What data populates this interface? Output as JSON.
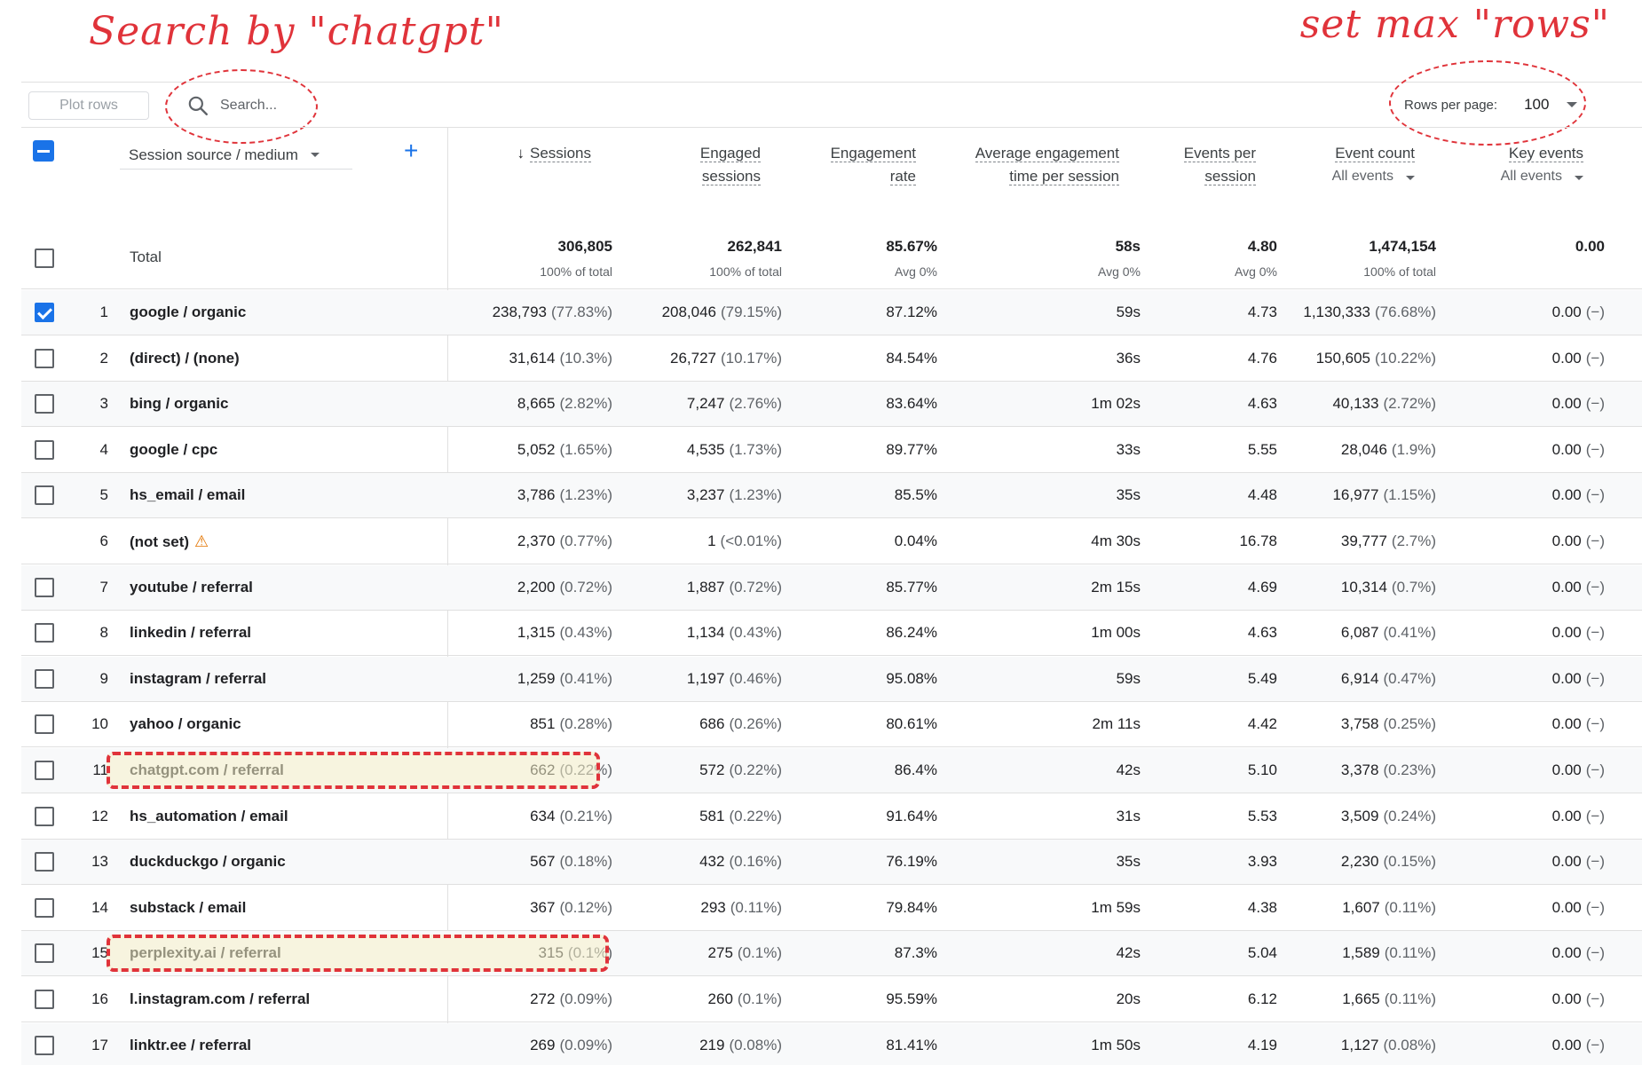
{
  "annotations": {
    "left": "Search by \"chatgpt\"",
    "right": "set max \"rows\""
  },
  "toolbar": {
    "plot_rows": "Plot rows",
    "search_placeholder": "Search...",
    "rows_per_page_label": "Rows per page:",
    "rows_per_page_value": "100"
  },
  "dimension": {
    "label": "Session source / medium"
  },
  "columns": [
    {
      "line1": "Sessions",
      "line2": "",
      "sort": true
    },
    {
      "line1": "Engaged",
      "line2": "sessions"
    },
    {
      "line1": "Engagement",
      "line2": "rate"
    },
    {
      "line1": "Average engagement",
      "line2": "time per session"
    },
    {
      "line1": "Events per",
      "line2": "session"
    },
    {
      "line1": "Event count",
      "line2": "All events"
    },
    {
      "line1": "Key events",
      "line2": "All events"
    }
  ],
  "total": {
    "label": "Total",
    "sessions": "306,805",
    "sessions_sub": "100% of total",
    "engaged": "262,841",
    "engaged_sub": "100% of total",
    "rate": "85.67%",
    "rate_sub": "Avg 0%",
    "avg_time": "58s",
    "avg_time_sub": "Avg 0%",
    "eps": "4.80",
    "eps_sub": "Avg 0%",
    "events": "1,474,154",
    "events_sub": "100% of total",
    "key": "0.00"
  },
  "rows": [
    {
      "idx": "1",
      "dim": "google / organic",
      "s": "238,793",
      "sp": "(77.83%)",
      "e": "208,046",
      "ep": "(79.15%)",
      "r": "87.12%",
      "t": "59s",
      "eps": "4.73",
      "ev": "1,130,333",
      "evp": "(76.68%)",
      "k": "0.00",
      "kp": "(−)"
    },
    {
      "idx": "2",
      "dim": "(direct) / (none)",
      "s": "31,614",
      "sp": "(10.3%)",
      "e": "26,727",
      "ep": "(10.17%)",
      "r": "84.54%",
      "t": "36s",
      "eps": "4.76",
      "ev": "150,605",
      "evp": "(10.22%)",
      "k": "0.00",
      "kp": "(−)"
    },
    {
      "idx": "3",
      "dim": "bing / organic",
      "s": "8,665",
      "sp": "(2.82%)",
      "e": "7,247",
      "ep": "(2.76%)",
      "r": "83.64%",
      "t": "1m 02s",
      "eps": "4.63",
      "ev": "40,133",
      "evp": "(2.72%)",
      "k": "0.00",
      "kp": "(−)"
    },
    {
      "idx": "4",
      "dim": "google / cpc",
      "s": "5,052",
      "sp": "(1.65%)",
      "e": "4,535",
      "ep": "(1.73%)",
      "r": "89.77%",
      "t": "33s",
      "eps": "5.55",
      "ev": "28,046",
      "evp": "(1.9%)",
      "k": "0.00",
      "kp": "(−)"
    },
    {
      "idx": "5",
      "dim": "hs_email / email",
      "s": "3,786",
      "sp": "(1.23%)",
      "e": "3,237",
      "ep": "(1.23%)",
      "r": "85.5%",
      "t": "35s",
      "eps": "4.48",
      "ev": "16,977",
      "evp": "(1.15%)",
      "k": "0.00",
      "kp": "(−)"
    },
    {
      "idx": "6",
      "dim": "(not set)",
      "s": "2,370",
      "sp": "(0.77%)",
      "e": "1",
      "ep": "(<0.01%)",
      "r": "0.04%",
      "t": "4m 30s",
      "eps": "16.78",
      "ev": "39,777",
      "evp": "(2.7%)",
      "k": "0.00",
      "kp": "(−)"
    },
    {
      "idx": "7",
      "dim": "youtube / referral",
      "s": "2,200",
      "sp": "(0.72%)",
      "e": "1,887",
      "ep": "(0.72%)",
      "r": "85.77%",
      "t": "2m 15s",
      "eps": "4.69",
      "ev": "10,314",
      "evp": "(0.7%)",
      "k": "0.00",
      "kp": "(−)"
    },
    {
      "idx": "8",
      "dim": "linkedin / referral",
      "s": "1,315",
      "sp": "(0.43%)",
      "e": "1,134",
      "ep": "(0.43%)",
      "r": "86.24%",
      "t": "1m 00s",
      "eps": "4.63",
      "ev": "6,087",
      "evp": "(0.41%)",
      "k": "0.00",
      "kp": "(−)"
    },
    {
      "idx": "9",
      "dim": "instagram / referral",
      "s": "1,259",
      "sp": "(0.41%)",
      "e": "1,197",
      "ep": "(0.46%)",
      "r": "95.08%",
      "t": "59s",
      "eps": "5.49",
      "ev": "6,914",
      "evp": "(0.47%)",
      "k": "0.00",
      "kp": "(−)"
    },
    {
      "idx": "10",
      "dim": "yahoo / organic",
      "s": "851",
      "sp": "(0.28%)",
      "e": "686",
      "ep": "(0.26%)",
      "r": "80.61%",
      "t": "2m 11s",
      "eps": "4.42",
      "ev": "3,758",
      "evp": "(0.25%)",
      "k": "0.00",
      "kp": "(−)"
    },
    {
      "idx": "11",
      "dim": "chatgpt.com / referral",
      "s": "662",
      "sp": "(0.22%)",
      "e": "572",
      "ep": "(0.22%)",
      "r": "86.4%",
      "t": "42s",
      "eps": "5.10",
      "ev": "3,378",
      "evp": "(0.23%)",
      "k": "0.00",
      "kp": "(−)"
    },
    {
      "idx": "12",
      "dim": "hs_automation / email",
      "s": "634",
      "sp": "(0.21%)",
      "e": "581",
      "ep": "(0.22%)",
      "r": "91.64%",
      "t": "31s",
      "eps": "5.53",
      "ev": "3,509",
      "evp": "(0.24%)",
      "k": "0.00",
      "kp": "(−)"
    },
    {
      "idx": "13",
      "dim": "duckduckgo / organic",
      "s": "567",
      "sp": "(0.18%)",
      "e": "432",
      "ep": "(0.16%)",
      "r": "76.19%",
      "t": "35s",
      "eps": "3.93",
      "ev": "2,230",
      "evp": "(0.15%)",
      "k": "0.00",
      "kp": "(−)"
    },
    {
      "idx": "14",
      "dim": "substack / email",
      "s": "367",
      "sp": "(0.12%)",
      "e": "293",
      "ep": "(0.11%)",
      "r": "79.84%",
      "t": "1m 59s",
      "eps": "4.38",
      "ev": "1,607",
      "evp": "(0.11%)",
      "k": "0.00",
      "kp": "(−)"
    },
    {
      "idx": "15",
      "dim": "perplexity.ai / referral",
      "s": "315",
      "sp": "(0.1%)",
      "e": "275",
      "ep": "(0.1%)",
      "r": "87.3%",
      "t": "42s",
      "eps": "5.04",
      "ev": "1,589",
      "evp": "(0.11%)",
      "k": "0.00",
      "kp": "(−)"
    },
    {
      "idx": "16",
      "dim": "l.instagram.com / referral",
      "s": "272",
      "sp": "(0.09%)",
      "e": "260",
      "ep": "(0.1%)",
      "r": "95.59%",
      "t": "20s",
      "eps": "6.12",
      "ev": "1,665",
      "evp": "(0.11%)",
      "k": "0.00",
      "kp": "(−)"
    },
    {
      "idx": "17",
      "dim": "linktr.ee / referral",
      "s": "269",
      "sp": "(0.09%)",
      "e": "219",
      "ep": "(0.08%)",
      "r": "81.41%",
      "t": "1m 50s",
      "eps": "4.19",
      "ev": "1,127",
      "evp": "(0.08%)",
      "k": "0.00",
      "kp": "(−)"
    }
  ]
}
